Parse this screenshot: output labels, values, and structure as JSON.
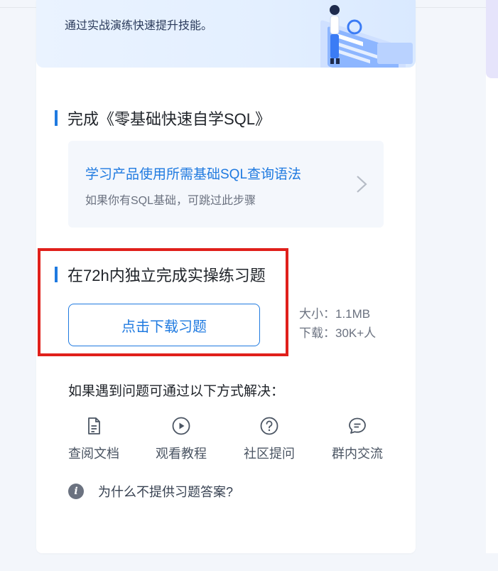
{
  "banner": {
    "subtitle": "通过实战演练快速提升技能。"
  },
  "step1": {
    "title": "完成《零基础快速自学SQL》",
    "link": "学习产品使用所需基础SQL查询语法",
    "hint": "如果你有SQL基础，可跳过此步骤"
  },
  "step2": {
    "title": "在72h内独立完成实操练习题",
    "download_label": "点击下载习题",
    "size": "大小：1.1MB",
    "downloads": "下载：30K+人"
  },
  "help": {
    "title": "如果遇到问题可通过以下方式解决：",
    "items": [
      {
        "label": "查阅文档",
        "icon": "document-icon"
      },
      {
        "label": "观看教程",
        "icon": "play-icon"
      },
      {
        "label": "社区提问",
        "icon": "question-icon"
      },
      {
        "label": "群内交流",
        "icon": "chat-icon"
      }
    ]
  },
  "faq": {
    "text": "为什么不提供习题答案?"
  },
  "colors": {
    "accent": "#1f7ae0",
    "highlight": "#e0201b"
  }
}
